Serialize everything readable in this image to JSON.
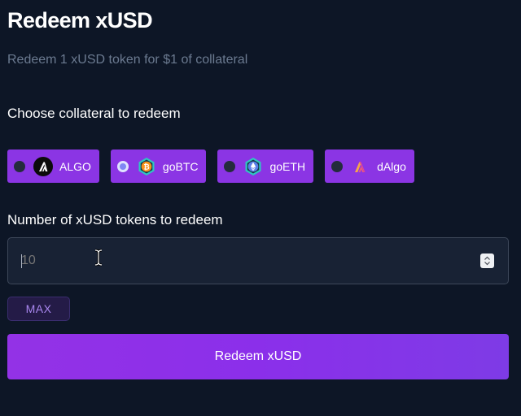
{
  "header": {
    "title": "Redeem xUSD",
    "subtitle": "Redeem 1 xUSD token for $1 of collateral"
  },
  "collateral": {
    "label": "Choose collateral to redeem",
    "selected": "goBTC",
    "options": [
      {
        "label": "ALGO",
        "icon": "algorand-logo-icon",
        "selected": false
      },
      {
        "label": "goBTC",
        "icon": "gobtc-logo-icon",
        "selected": true
      },
      {
        "label": "goETH",
        "icon": "goeth-logo-icon",
        "selected": false
      },
      {
        "label": "dAlgo",
        "icon": "dalgo-logo-icon",
        "selected": false
      }
    ]
  },
  "amount": {
    "label": "Number of xUSD tokens to redeem",
    "placeholder": "10",
    "value": ""
  },
  "actions": {
    "max_label": "MAX",
    "redeem_label": "Redeem xUSD"
  },
  "colors": {
    "background": "#0d1626",
    "accent": "#8b35e4",
    "input_background": "#182234",
    "muted_text": "#6b7a90"
  }
}
